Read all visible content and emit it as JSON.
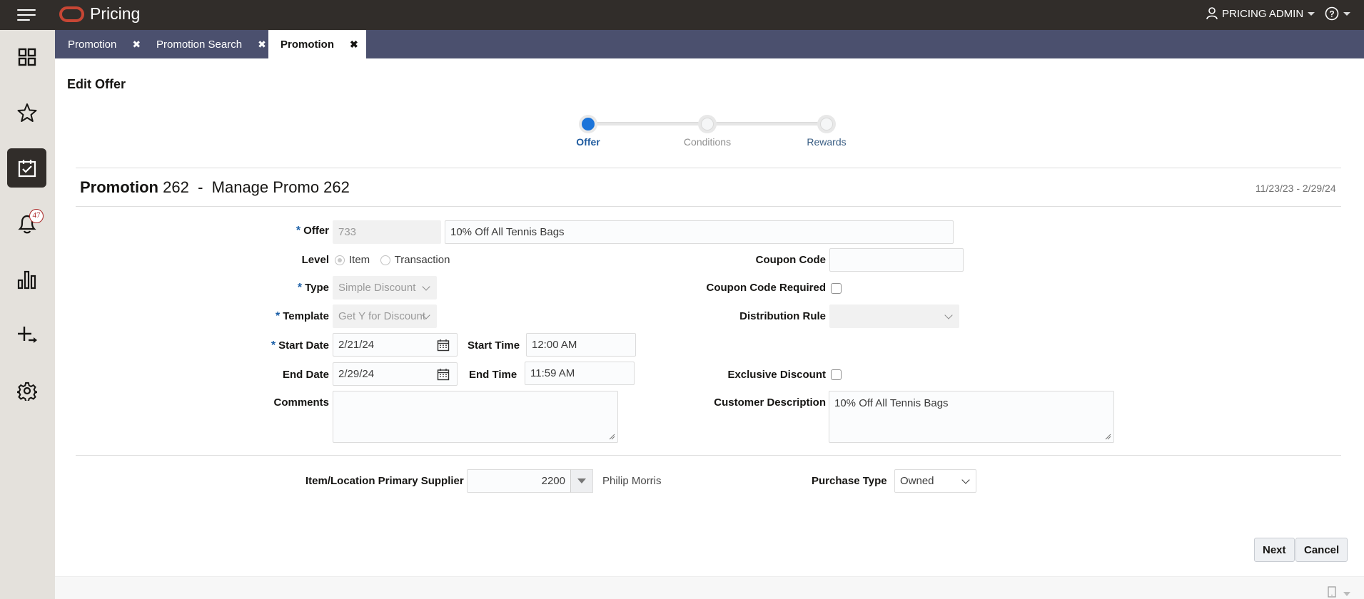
{
  "app": {
    "title": "Pricing",
    "brand_color": "#c74634",
    "header_bg": "#312d2a",
    "tabbar_bg": "#4b506e",
    "user_label": "PRICING ADMIN",
    "icons": {
      "menu": "hamburger-menu-icon",
      "user": "user-icon",
      "help": "help-icon"
    }
  },
  "sidebar": {
    "items": [
      {
        "name": "dashboard",
        "icon": "grid-icon",
        "active": false
      },
      {
        "name": "favorites",
        "icon": "star-icon",
        "active": false
      },
      {
        "name": "tasks",
        "icon": "calendar-check-icon",
        "active": true
      },
      {
        "name": "notifications",
        "icon": "bell-icon",
        "badge": "47",
        "active": false
      },
      {
        "name": "reports",
        "icon": "bar-chart-icon",
        "active": false
      },
      {
        "name": "create",
        "icon": "plus-arrow-icon",
        "active": false
      },
      {
        "name": "settings",
        "icon": "gear-icon",
        "active": false
      }
    ]
  },
  "tabs": [
    {
      "label": "Promotion",
      "active": false,
      "close": "✖"
    },
    {
      "label": "Promotion Search",
      "active": false,
      "close": "✖"
    },
    {
      "label": "Promotion",
      "active": true,
      "close": "✖"
    }
  ],
  "page": {
    "heading": "Edit Offer",
    "train": {
      "steps": [
        {
          "label": "Offer",
          "state": "current",
          "color": "#1f5b9f"
        },
        {
          "label": "Conditions",
          "state": "disabled",
          "color": "#8f8f8f"
        },
        {
          "label": "Rewards",
          "state": "visited",
          "color": "#3a5e84"
        }
      ],
      "accent": "#1a73d9"
    },
    "promo_title": {
      "prefix": "Promotion",
      "number": "262",
      "separator": "-",
      "name": "Manage Promo 262"
    },
    "date_range": "11/23/23  -  2/29/24"
  },
  "form": {
    "offer": {
      "label": "Offer",
      "required": true,
      "id_value": "733",
      "description_value": "10% Off All Tennis Bags"
    },
    "level": {
      "label": "Level",
      "options": [
        "Item",
        "Transaction"
      ],
      "selected": "Item"
    },
    "type": {
      "label": "Type",
      "required": true,
      "value": "Simple Discount"
    },
    "template": {
      "label": "Template",
      "required": true,
      "value": "Get Y for Discount"
    },
    "start_date": {
      "label": "Start Date",
      "required": true,
      "value": "2/21/24"
    },
    "start_time": {
      "label": "Start Time",
      "value": "12:00 AM"
    },
    "end_date": {
      "label": "End Date",
      "value": "2/29/24"
    },
    "end_time": {
      "label": "End Time",
      "value": "11:59 AM"
    },
    "comments": {
      "label": "Comments",
      "value": ""
    },
    "coupon_code": {
      "label": "Coupon Code",
      "value": ""
    },
    "coupon_code_required": {
      "label": "Coupon Code Required",
      "checked": false
    },
    "distribution_rule": {
      "label": "Distribution Rule",
      "value": ""
    },
    "exclusive_discount": {
      "label": "Exclusive Discount",
      "checked": false
    },
    "customer_description": {
      "label": "Customer Description",
      "value": "10% Off All Tennis Bags"
    },
    "primary_supplier": {
      "label": "Item/Location Primary Supplier",
      "value": "2200",
      "supplier_name": "Philip Morris"
    },
    "purchase_type": {
      "label": "Purchase Type",
      "value": "Owned"
    }
  },
  "actions": {
    "next_label": "Next",
    "cancel_label": "Cancel"
  }
}
